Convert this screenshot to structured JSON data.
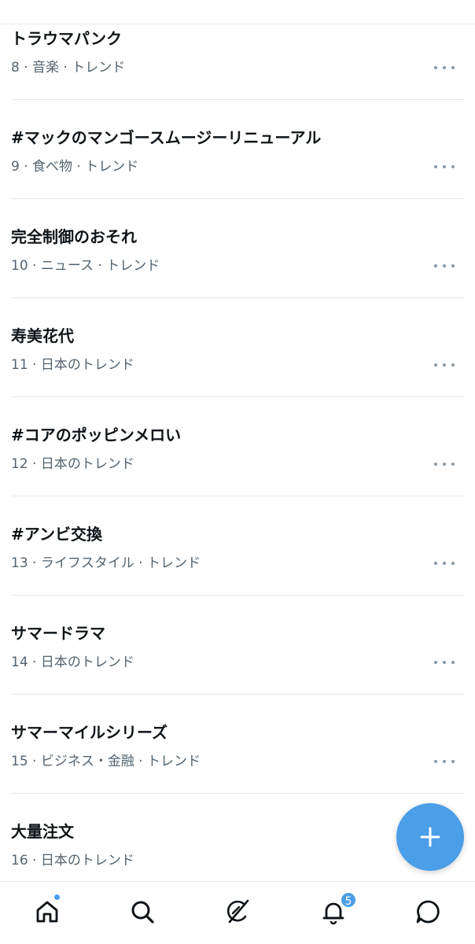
{
  "trends": [
    {
      "title": "トラウマパンク",
      "meta": "8 · 音楽 · トレンド"
    },
    {
      "title": "#マックのマンゴースムージーリニューアル",
      "meta": "9 · 食べ物 · トレンド"
    },
    {
      "title": "完全制御のおそれ",
      "meta": "10 · ニュース · トレンド"
    },
    {
      "title": "寿美花代",
      "meta": "11 · 日本のトレンド"
    },
    {
      "title": "#コアのポッピンメロい",
      "meta": "12 · 日本のトレンド"
    },
    {
      "title": "#アンビ交換",
      "meta": "13 · ライフスタイル · トレンド"
    },
    {
      "title": "サマードラマ",
      "meta": "14 · 日本のトレンド"
    },
    {
      "title": "サマーマイルシリーズ",
      "meta": "15 · ビジネス・金融 · トレンド"
    },
    {
      "title": "大量注文",
      "meta": "16 · 日本のトレンド"
    }
  ],
  "fab": {
    "icon": "plus-icon"
  },
  "tabbar": {
    "items": [
      {
        "icon": "home-icon",
        "has_dot": true
      },
      {
        "icon": "search-icon"
      },
      {
        "icon": "grok-icon"
      },
      {
        "icon": "bell-icon",
        "badge": "5"
      },
      {
        "icon": "message-icon"
      }
    ]
  },
  "colors": {
    "accent": "#4b9ee8",
    "text": "#0f1419",
    "secondary_text": "#536471",
    "divider": "#e6e8ea"
  }
}
